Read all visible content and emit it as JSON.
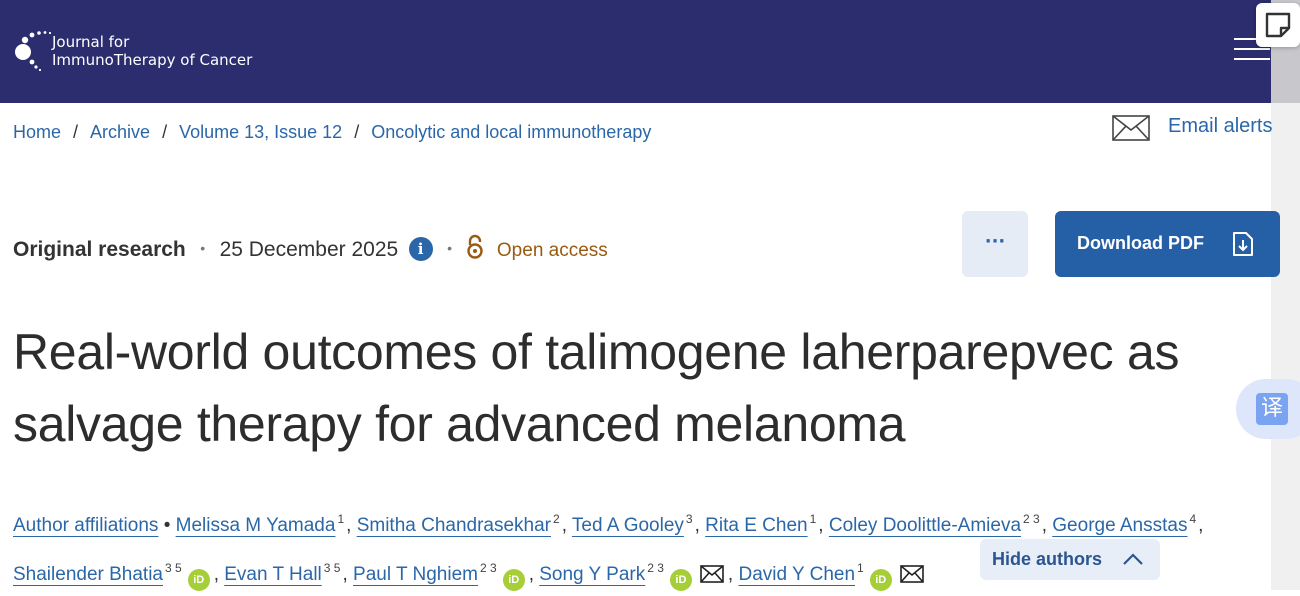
{
  "header": {
    "logo_line1": "Journal for",
    "logo_line2": "ImmunoTherapy of Cancer",
    "background_color": "#2b2d6e",
    "menu_icon": "hamburger-menu-icon"
  },
  "breadcrumb": {
    "items": [
      "Home",
      "Archive",
      "Volume 13, Issue 12",
      "Oncolytic and local immunotherapy"
    ],
    "separator": "/"
  },
  "email_alerts": {
    "label": "Email alerts",
    "icon": "envelope-icon"
  },
  "meta": {
    "article_type": "Original research",
    "date": "25 December 2025",
    "info_icon_glyph": "i",
    "open_access_label": "Open access",
    "bullet": "•"
  },
  "actions": {
    "more_label": "···",
    "download_pdf_label": "Download PDF"
  },
  "title": "Real-world outcomes of talimogene laherparepvec as salvage therapy for advanced melanoma",
  "authors": {
    "affiliations_label": "Author affiliations",
    "list": [
      {
        "name": "Melissa M Yamada",
        "sup": "1"
      },
      {
        "name": "Smitha Chandrasekhar",
        "sup": "2"
      },
      {
        "name": "Ted A Gooley",
        "sup": "3"
      },
      {
        "name": "Rita E Chen",
        "sup": "1"
      },
      {
        "name": "Coley Doolittle-Amieva",
        "sup": "2 3"
      },
      {
        "name": "George Ansstas",
        "sup": "4"
      },
      {
        "name": "Shailender Bhatia",
        "sup": "3 5"
      },
      {
        "name": "Evan T Hall",
        "sup": "3 5"
      },
      {
        "name": "Paul T Nghiem",
        "sup": "2 3"
      },
      {
        "name": "Song Y Park",
        "sup": "2 3"
      },
      {
        "name": "David Y Chen",
        "sup": "1"
      }
    ],
    "orcid_label": "iD",
    "hide_authors_label": "Hide authors"
  },
  "translate": {
    "label": "译"
  },
  "colors": {
    "link": "#2b67a8",
    "pdf_button": "#2560a7",
    "open_access": "#9a5a10",
    "orcid": "#a6ce39"
  }
}
